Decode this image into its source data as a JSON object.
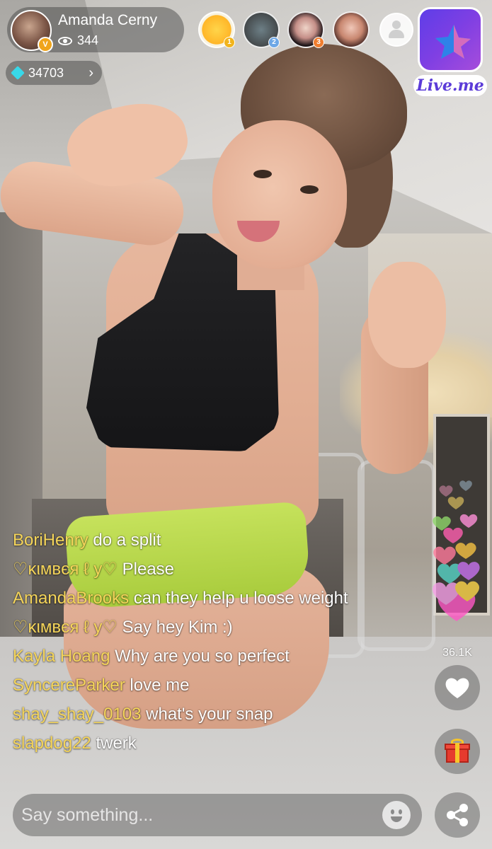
{
  "host": {
    "name": "Amanda Cerny",
    "viewer_count": "344",
    "level_badge": "V",
    "diamonds": "34703"
  },
  "viewers": [
    {
      "icon": "sun-avatar",
      "badge": "1"
    },
    {
      "icon": "photo-avatar",
      "badge": "2"
    },
    {
      "icon": "photo-avatar",
      "badge": "3"
    },
    {
      "icon": "photo-avatar",
      "badge": ""
    },
    {
      "icon": "person-placeholder-icon",
      "badge": ""
    }
  ],
  "logo": {
    "text": "Live.me",
    "icon": "star-logo-icon"
  },
  "chat": [
    {
      "user": "BoriHenry",
      "text": "do a split"
    },
    {
      "user": "♡ĸιмвєя ℓ у♡",
      "text": "Please"
    },
    {
      "user": "AmandaBrooks",
      "text": "can they help u loose weight"
    },
    {
      "user": "♡ĸιмвєя ℓ у♡",
      "text": "Say hey Kim :)"
    },
    {
      "user": "Kayla Hoang",
      "text": "Why are you so perfect"
    },
    {
      "user": "SyncereParker",
      "text": "love me"
    },
    {
      "user": "shay_shay_0103",
      "text": "what's your snap"
    },
    {
      "user": "slapdog22",
      "text": "twerk"
    }
  ],
  "likes": {
    "count": "36.1K"
  },
  "input": {
    "placeholder": "Say something..."
  },
  "colors": {
    "username": "#f5d55a",
    "brand_purple": "#5e3ee8",
    "diamond": "#38d8e8",
    "gift_red": "#e63b2e"
  }
}
